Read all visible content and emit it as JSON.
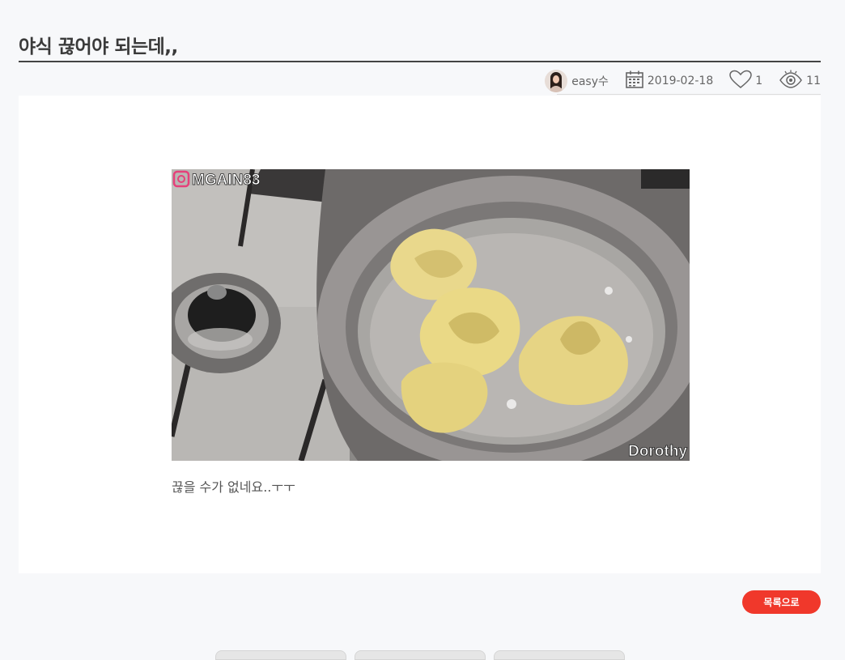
{
  "post": {
    "title": "야식 끊어야 되는데,,",
    "author": "easy수",
    "date": "2019-02-18",
    "likes": "1",
    "views": "11",
    "caption": "끊을 수가 없네요..ㅜㅜ"
  },
  "image": {
    "overlay_left": "MGAIN83",
    "overlay_right": "Dorothy"
  },
  "actions": {
    "list_button": "목록으로"
  },
  "icons": {
    "avatar": "author-avatar",
    "date": "calendar-icon",
    "likes": "heart-icon",
    "views": "eye-icon",
    "overlay": "instagram-icon"
  },
  "colors": {
    "accent": "#f0382b",
    "background": "#f7f8fa"
  }
}
